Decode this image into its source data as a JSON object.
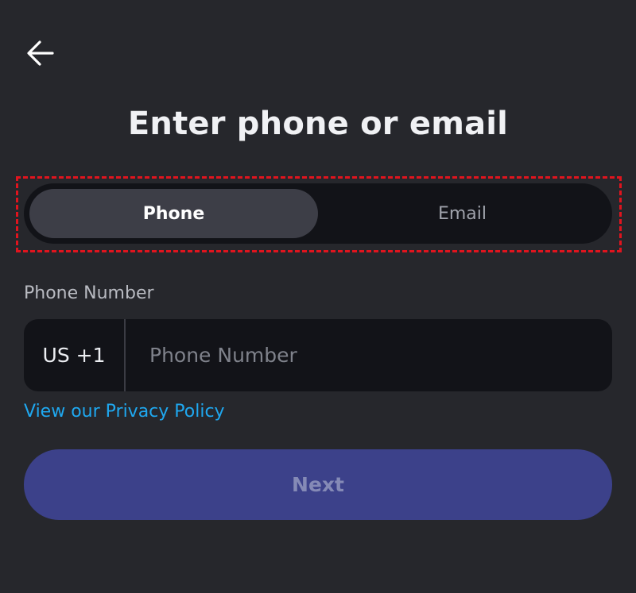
{
  "header": {
    "back_icon": "arrow-left-icon",
    "title": "Enter phone or email"
  },
  "toggle": {
    "options": [
      {
        "label": "Phone",
        "selected": true
      },
      {
        "label": "Email",
        "selected": false
      }
    ]
  },
  "phone_field": {
    "label": "Phone Number",
    "country_code": "US +1",
    "placeholder": "Phone Number",
    "value": ""
  },
  "privacy_link": {
    "label": "View our Privacy Policy"
  },
  "next_button": {
    "label": "Next",
    "enabled": false
  },
  "colors": {
    "background": "#26272c",
    "input_background": "#121318",
    "toggle_active": "#3d3e47",
    "link": "#1fa8f0",
    "button": "#3c418a",
    "highlight": "#e0141e"
  }
}
